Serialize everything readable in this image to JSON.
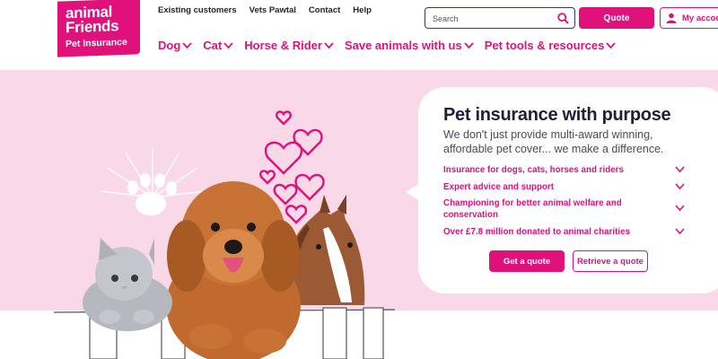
{
  "logo": {
    "line1": "animal",
    "line2": "Friends",
    "line3": "Pet Insurance"
  },
  "topnav": [
    "Existing customers",
    "Vets Pawtal",
    "Contact",
    "Help"
  ],
  "mainnav": [
    "Dog",
    "Cat",
    "Horse & Rider",
    "Save animals with us",
    "Pet tools & resources"
  ],
  "search": {
    "placeholder": "Search"
  },
  "header": {
    "quote_label": "Quote",
    "account_label": "My account"
  },
  "hero": {
    "title": "Pet insurance with purpose",
    "subtitle": "We don't just provide multi-award winning, affordable pet cover... we make a difference.",
    "features": [
      "Insurance for dogs, cats, horses and riders",
      "Expert advice and support",
      "Championing for better animal welfare and conservation",
      "Over £7.8 million donated to animal charities"
    ],
    "get_quote": "Get a quote",
    "retrieve_quote": "Retrieve a quote"
  },
  "colors": {
    "brand": "#e0117a",
    "hero_bg": "#f9d8e8",
    "text_dark": "#1f1f3a"
  }
}
